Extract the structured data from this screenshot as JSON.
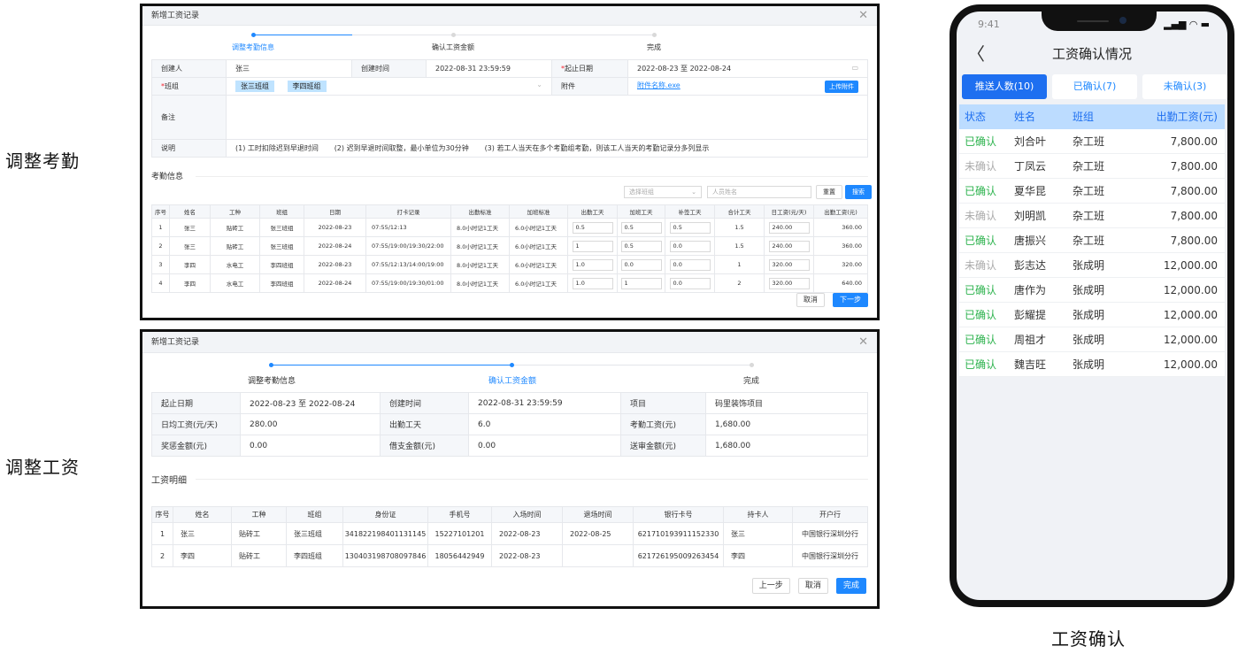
{
  "side_labels": {
    "top": "调整考勤",
    "middle": "调整工资",
    "bottom": "工资确认"
  },
  "panel1": {
    "title": "新增工资记录",
    "close": "✕",
    "steps": [
      "调整考勤信息",
      "确认工资金额",
      "完成"
    ],
    "form": {
      "creator_label": "创建人",
      "creator": "张三",
      "created_label": "创建时间",
      "created": "2022-08-31  23:59:59",
      "start_label": "起止日期",
      "start": "2022-08-23 至 2022-08-24",
      "team_label": "班组",
      "team_tags": [
        "张三班组",
        "李四班组"
      ],
      "attach_label": "附件",
      "attach_file": "附件名称.exe",
      "upload_button": "上传附件",
      "remark_label": "备注",
      "note_label": "说明",
      "notes": [
        "(1) 工时扣除迟到早退时间",
        "(2) 迟到早退时间取整，最小单位为30分钟",
        "(3) 若工人当天在多个考勤组考勤，则该工人当天的考勤记录分多列显示"
      ]
    },
    "section_title": "考勤信息",
    "filter": {
      "team_placeholder": "选择班组",
      "name_placeholder": "人员姓名",
      "reset": "重置",
      "search": "搜索"
    },
    "columns": [
      "序号",
      "姓名",
      "工种",
      "班组",
      "日期",
      "打卡记录",
      "出勤标准",
      "加班标准",
      "出勤工天",
      "加班工天",
      "补签工天",
      "合计工天",
      "日工资(元/天)",
      "出勤工资(元)"
    ],
    "rows": [
      [
        "1",
        "张三",
        "贴砖工",
        "张三班组",
        "2022-08-23",
        "07:55/12:13",
        "8.0小时记1工天",
        "6.0小时记1工天",
        "0.5",
        "0.5",
        "0.5",
        "1.5",
        "240.00",
        "360.00"
      ],
      [
        "2",
        "张三",
        "贴砖工",
        "张三班组",
        "2022-08-24",
        "07:55/19:00/19:30/22:00",
        "8.0小时记1工天",
        "6.0小时记1工天",
        "1",
        "0.5",
        "0.0",
        "1.5",
        "240.00",
        "360.00"
      ],
      [
        "3",
        "李四",
        "水电工",
        "李四班组",
        "2022-08-23",
        "07:55/12:13/14:00/19:00",
        "8.0小时记1工天",
        "6.0小时记1工天",
        "1.0",
        "0.0",
        "0.0",
        "1",
        "320.00",
        "320.00"
      ],
      [
        "4",
        "李四",
        "水电工",
        "李四班组",
        "2022-08-24",
        "07:55/19:00/19:30/01:00",
        "8.0小时记1工天",
        "6.0小时记1工天",
        "1.0",
        "1",
        "0.0",
        "2",
        "320.00",
        "640.00"
      ]
    ],
    "cancel": "取消",
    "next": "下一步"
  },
  "panel2": {
    "title": "新增工资记录",
    "close": "✕",
    "steps": [
      "调整考勤信息",
      "确认工资金额",
      "完成"
    ],
    "info": [
      [
        "起止日期",
        "2022-08-23 至 2022-08-24",
        "创建时间",
        "2022-08-31  23:59:59",
        "项目",
        "码里装饰项目"
      ],
      [
        "日均工资(元/天)",
        "280.00",
        "出勤工天",
        "6.0",
        "考勤工资(元)",
        "1,680.00"
      ],
      [
        "奖惩金额(元)",
        "0.00",
        "借支金额(元)",
        "0.00",
        "送审金额(元)",
        "1,680.00"
      ]
    ],
    "section_title": "工资明细",
    "columns": [
      "序号",
      "姓名",
      "工种",
      "班组",
      "身份证",
      "手机号",
      "入场时间",
      "退场时间",
      "银行卡号",
      "持卡人",
      "开户行"
    ],
    "rows": [
      [
        "1",
        "张三",
        "贴砖工",
        "张三班组",
        "341822198401131145",
        "15227101201",
        "2022-08-23",
        "2022-08-25",
        "621710193911152330",
        "张三",
        "中国银行深圳分行"
      ],
      [
        "2",
        "李四",
        "贴砖工",
        "李四班组",
        "130403198708097846",
        "18056442949",
        "2022-08-23",
        "",
        "621726195009263454",
        "李四",
        "中国银行深圳分行"
      ]
    ],
    "prev": "上一步",
    "cancel": "取消",
    "done": "完成"
  },
  "phone": {
    "time": "9:41",
    "status_icons": "▂▄▆ ◠ ▬",
    "back": "〈",
    "title": "工资确认情况",
    "tabs": [
      "推送人数(10)",
      "已确认(7)",
      "未确认(3)"
    ],
    "columns": [
      "状态",
      "姓名",
      "班组",
      "出勤工资(元)"
    ],
    "rows": [
      {
        "status": "已确认",
        "confirmed": true,
        "name": "刘合叶",
        "team": "杂工班",
        "wage": "7,800.00"
      },
      {
        "status": "未确认",
        "confirmed": false,
        "name": "丁凤云",
        "team": "杂工班",
        "wage": "7,800.00"
      },
      {
        "status": "已确认",
        "confirmed": true,
        "name": "夏华昆",
        "team": "杂工班",
        "wage": "7,800.00"
      },
      {
        "status": "未确认",
        "confirmed": false,
        "name": "刘明凯",
        "team": "杂工班",
        "wage": "7,800.00"
      },
      {
        "status": "已确认",
        "confirmed": true,
        "name": "唐振兴",
        "team": "杂工班",
        "wage": "7,800.00"
      },
      {
        "status": "未确认",
        "confirmed": false,
        "name": "彭志达",
        "team": "张成明",
        "wage": "12,000.00"
      },
      {
        "status": "已确认",
        "confirmed": true,
        "name": "唐作为",
        "team": "张成明",
        "wage": "12,000.00"
      },
      {
        "status": "已确认",
        "confirmed": true,
        "name": "彭耀提",
        "team": "张成明",
        "wage": "12,000.00"
      },
      {
        "status": "已确认",
        "confirmed": true,
        "name": "周祖才",
        "team": "张成明",
        "wage": "12,000.00"
      },
      {
        "status": "已确认",
        "confirmed": true,
        "name": "魏吉旺",
        "team": "张成明",
        "wage": "12,000.00"
      }
    ],
    "colors": {
      "primary": "#1e6ff0",
      "confirmed": "#2bb24c",
      "unconfirmed": "#aaaaaa"
    }
  }
}
